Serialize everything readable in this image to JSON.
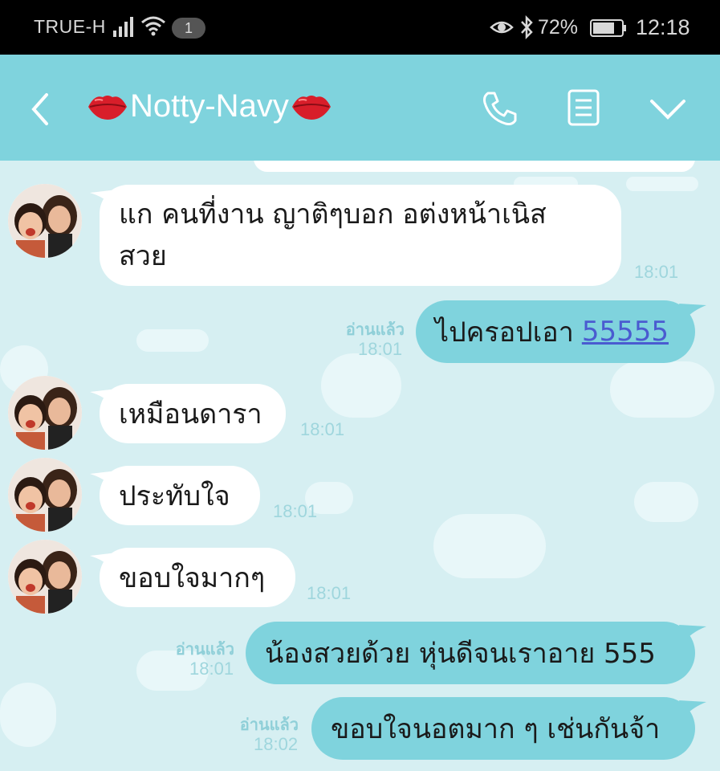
{
  "status_bar": {
    "carrier": "TRUE-H",
    "notification_count": "1",
    "battery_percent": "72%",
    "clock": "12:18"
  },
  "header": {
    "title": "Notty-Navy",
    "icons": [
      "back-arrow-icon",
      "lips-emoji-icon",
      "phone-icon",
      "notes-icon",
      "chevron-down-icon"
    ],
    "accent_color": "#7fd3dd"
  },
  "messages": [
    {
      "dir": "in",
      "text_line1": "แก คนที่งาน ญาติๆบอก อต่งหน้าเนิส",
      "text_line2": "สวย",
      "time": "18:01"
    },
    {
      "dir": "out",
      "text": "ไปครอปเอา",
      "link": "55555",
      "read": "อ่านแล้ว",
      "time": "18:01"
    },
    {
      "dir": "in",
      "text": "เหมือนดารา",
      "time": "18:01"
    },
    {
      "dir": "in",
      "text": "ประทับใจ",
      "time": "18:01"
    },
    {
      "dir": "in",
      "text": "ขอบใจมากๆ",
      "time": "18:01"
    },
    {
      "dir": "out",
      "text": "น้องสวยด้วย หุ่นดีจนเราอาย 555",
      "read": "อ่านแล้ว",
      "time": "18:01"
    },
    {
      "dir": "out",
      "text": "ขอบใจนอตมาก ๆ เช่นกันจ้า",
      "read": "อ่านแล้ว",
      "time": "18:02"
    }
  ]
}
